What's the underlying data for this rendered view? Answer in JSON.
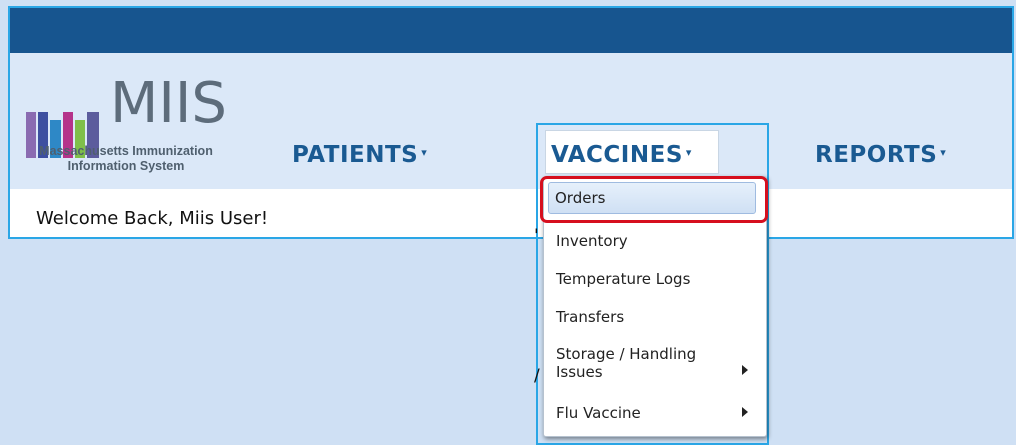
{
  "header": {
    "bar_color": "#17558f",
    "background": "#dbe8f8"
  },
  "brand": {
    "wordmark": "MIIS",
    "subtitle_line1": "Massachusetts Immunization",
    "subtitle_line2": "Information System",
    "bar_colors": [
      "#8a6bb1",
      "#3d4fa0",
      "#2e88c6",
      "#b5338a",
      "#7fbf4a",
      "#5c5c9d"
    ]
  },
  "nav": {
    "items": [
      {
        "label": "PATIENTS",
        "caret": "▾"
      },
      {
        "label": "VACCINES",
        "caret": "▾",
        "active": true
      },
      {
        "label": "REPORTS",
        "caret": "▾"
      }
    ]
  },
  "welcome": {
    "text": "Welcome Back, Miis User!"
  },
  "dropdown": {
    "items": [
      {
        "label": "Orders",
        "highlighted": true,
        "submenu": false
      },
      {
        "label": "Inventory",
        "submenu": false
      },
      {
        "label": "Temperature Logs",
        "submenu": false
      },
      {
        "label": "Transfers",
        "submenu": false
      },
      {
        "label_line1": "Storage / Handling",
        "label_line2": "Issues",
        "submenu": true
      },
      {
        "label": "Flu Vaccine",
        "submenu": true
      }
    ]
  },
  "annotation": {
    "highlight_color": "#d60f1e"
  }
}
